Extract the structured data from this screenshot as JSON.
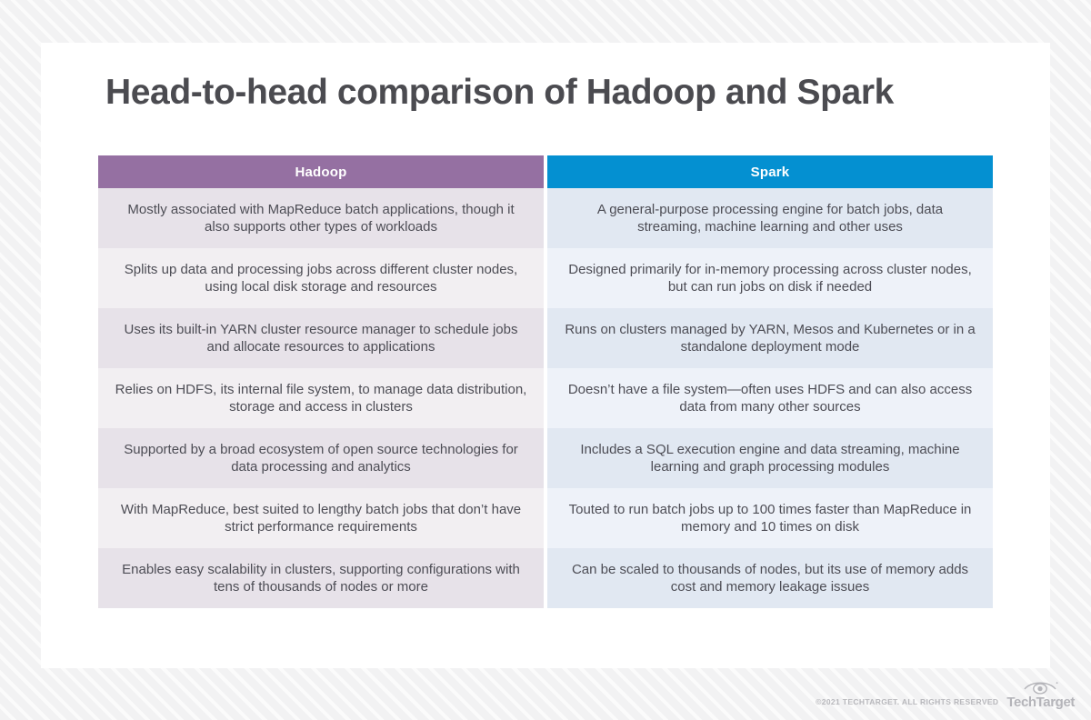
{
  "page": {
    "title": "Head-to-head comparison of Hadoop and Spark"
  },
  "table": {
    "columns": [
      {
        "label": "Hadoop",
        "accent": "#9570a2"
      },
      {
        "label": "Spark",
        "accent": "#0490d1"
      }
    ],
    "rows": [
      {
        "hadoop": "Mostly associated with MapReduce batch applications, though it also supports other types of workloads",
        "spark": "A general-purpose processing engine for batch jobs, data streaming, machine learning and other uses"
      },
      {
        "hadoop": "Splits up data and processing jobs across different cluster nodes, using local disk storage and resources",
        "spark": "Designed primarily for in-memory processing across cluster nodes, but can run jobs on disk if needed"
      },
      {
        "hadoop": "Uses its built-in YARN cluster resource manager to schedule jobs and allocate resources to applications",
        "spark": "Runs on clusters managed by YARN, Mesos and Kubernetes or in a standalone deployment mode"
      },
      {
        "hadoop": "Relies on HDFS, its internal file system, to manage data distribution, storage and access in clusters",
        "spark": "Doesn’t have a file system—often uses HDFS and can also access data from many other sources"
      },
      {
        "hadoop": "Supported by a broad ecosystem of open source technologies for data processing and analytics",
        "spark": "Includes a SQL execution engine and data streaming, machine learning and graph processing modules"
      },
      {
        "hadoop": "With MapReduce, best suited to lengthy batch jobs that don’t have strict performance requirements",
        "spark": "Touted to run batch jobs up to 100 times faster than MapReduce in memory and 10 times on disk"
      },
      {
        "hadoop": "Enables easy scalability in clusters, supporting configurations with tens of thousands of nodes or more",
        "spark": "Can be scaled to thousands of nodes, but its use of memory adds cost and memory leakage issues"
      }
    ]
  },
  "footer": {
    "copyright": "©2021 TECHTARGET. ALL RIGHTS RESERVED",
    "brand": "TechTarget"
  }
}
